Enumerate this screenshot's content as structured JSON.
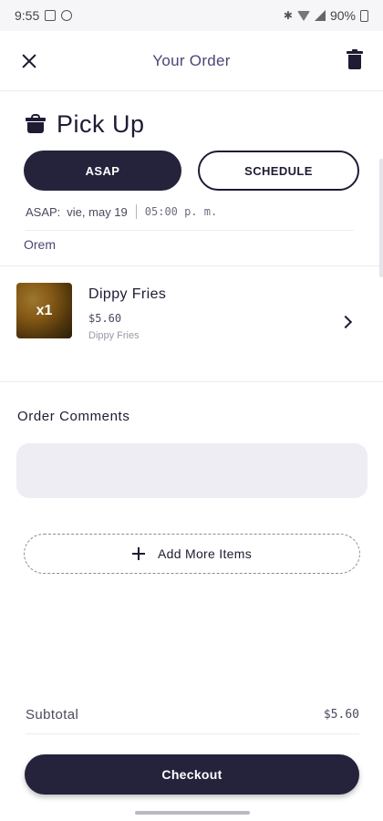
{
  "status_bar": {
    "time": "9:55",
    "battery": "90%",
    "icons": [
      "gallery-icon",
      "settings-icon",
      "bluetooth-icon",
      "wifi-icon",
      "signal-icon",
      "battery-icon"
    ]
  },
  "header": {
    "title": "Your Order",
    "close_icon": "close-icon",
    "delete_icon": "trash-icon"
  },
  "pickup": {
    "title": "Pick Up",
    "icon": "bag-icon",
    "asap_label": "ASAP",
    "schedule_label": "SCHEDULE",
    "asap_prefix": "ASAP:",
    "date": "vie, may 19",
    "time": "05:00 p. m.",
    "store": "Orem"
  },
  "cart": {
    "items": [
      {
        "qty": "x1",
        "name": "Dippy Fries",
        "price": "$5.60",
        "detail": "Dippy Fries"
      }
    ]
  },
  "comments": {
    "label": "Order Comments",
    "placeholder": "",
    "value": ""
  },
  "add_more": {
    "label": "Add More Items",
    "icon": "plus-icon"
  },
  "summary": {
    "subtotal_label": "Subtotal",
    "subtotal_value": "$5.60"
  },
  "checkout": {
    "label": "Checkout"
  },
  "colors": {
    "primary": "#25223b",
    "accent_text": "#4a4675",
    "input_bg": "#ededf3",
    "divider": "#ececf0"
  }
}
